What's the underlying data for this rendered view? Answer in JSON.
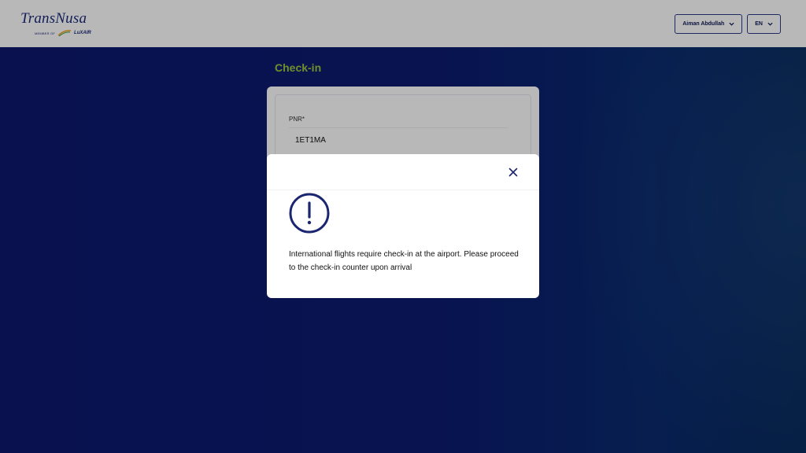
{
  "header": {
    "logo_text": "TransNusa",
    "logo_sub_small": "MEMBER OF",
    "logo_sub_brand": "LuXAIR",
    "user_name": "Aiman Abdullah",
    "language": "EN"
  },
  "page": {
    "title": "Check-in"
  },
  "form": {
    "pnr_label": "PNR*",
    "pnr_value": "1ET1MA"
  },
  "modal": {
    "message": "International flights require check-in at the airport. Please proceed to the check-in counter upon arrival"
  },
  "colors": {
    "brand_navy": "#1d2a7a",
    "title_green": "#9cc63c",
    "background_blue": "#0d1a6b",
    "icon_navy": "#1b2670"
  },
  "icons": {
    "user_dropdown": "chevron-down-icon",
    "lang_dropdown": "chevron-down-icon",
    "close": "close-icon",
    "alert": "exclamation-circle-icon"
  }
}
